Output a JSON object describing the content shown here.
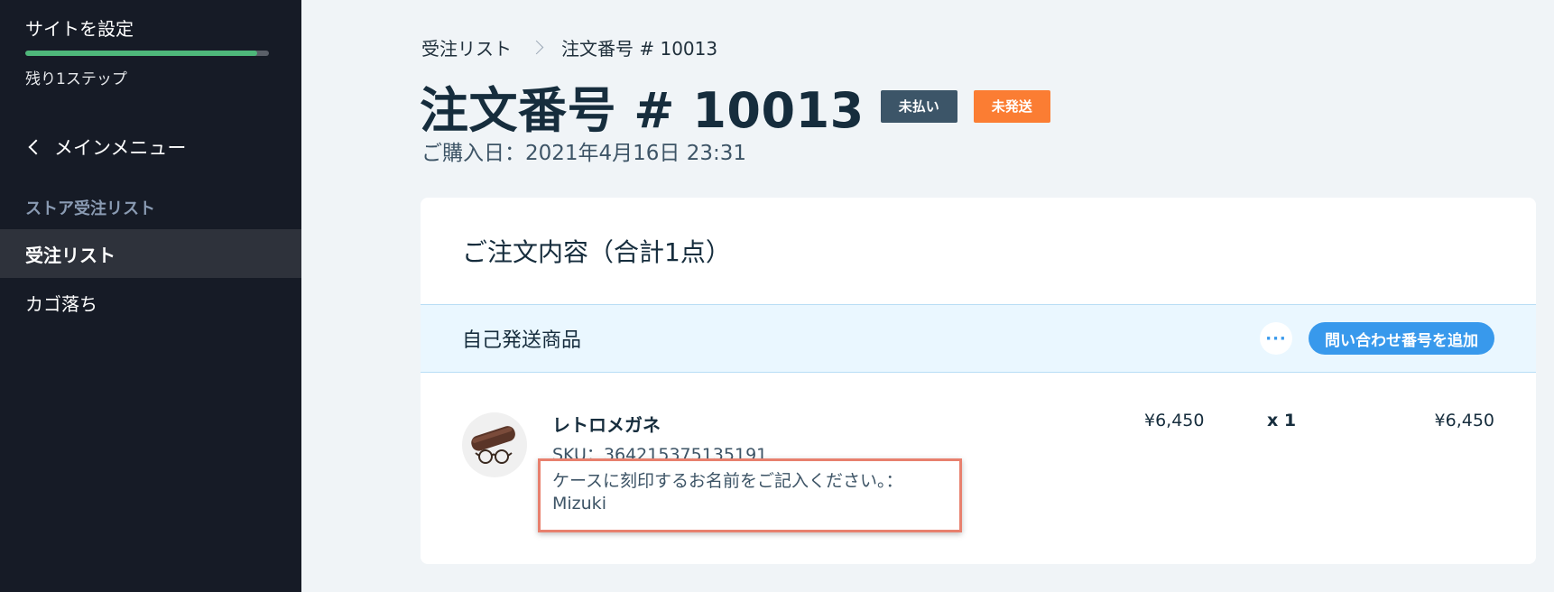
{
  "sidebar": {
    "setup_title": "サイトを設定",
    "setup_progress": 0.95,
    "setup_steps": "残り1ステップ",
    "back_label": "メインメニュー",
    "section_label": "ストア受注リスト",
    "items": [
      {
        "label": "受注リスト",
        "active": true
      },
      {
        "label": "カゴ落ち",
        "active": false
      }
    ]
  },
  "breadcrumb": {
    "parent": "受注リスト",
    "current": "注文番号 # 10013"
  },
  "header": {
    "title": "注文番号 # 10013",
    "badge_payment": "未払い",
    "badge_fulfillment": "未発送",
    "purchase_date": "ご購入日：2021年4月16日 23:31"
  },
  "order_card": {
    "title": "ご注文内容（合計1点）",
    "fulfillment_label": "自己発送商品",
    "more_label": "···",
    "add_tracking_label": "問い合わせ番号を追加",
    "items": [
      {
        "name": "レトロメガネ",
        "sku": "SKU：364215375135191",
        "custom_field_label": "ケースに刻印するお名前をご記入ください。：",
        "custom_field_value": "Mizuki",
        "unit_price": "¥6,450",
        "quantity": "x 1",
        "total": "¥6,450"
      }
    ]
  },
  "colors": {
    "sidebar_bg": "#161b26",
    "progress_fill": "#4eb77a",
    "badge_unpaid": "#3c5568",
    "badge_unfulfilled": "#fb7d33",
    "accent_blue": "#3899ec",
    "highlight_border": "#e8806e"
  }
}
